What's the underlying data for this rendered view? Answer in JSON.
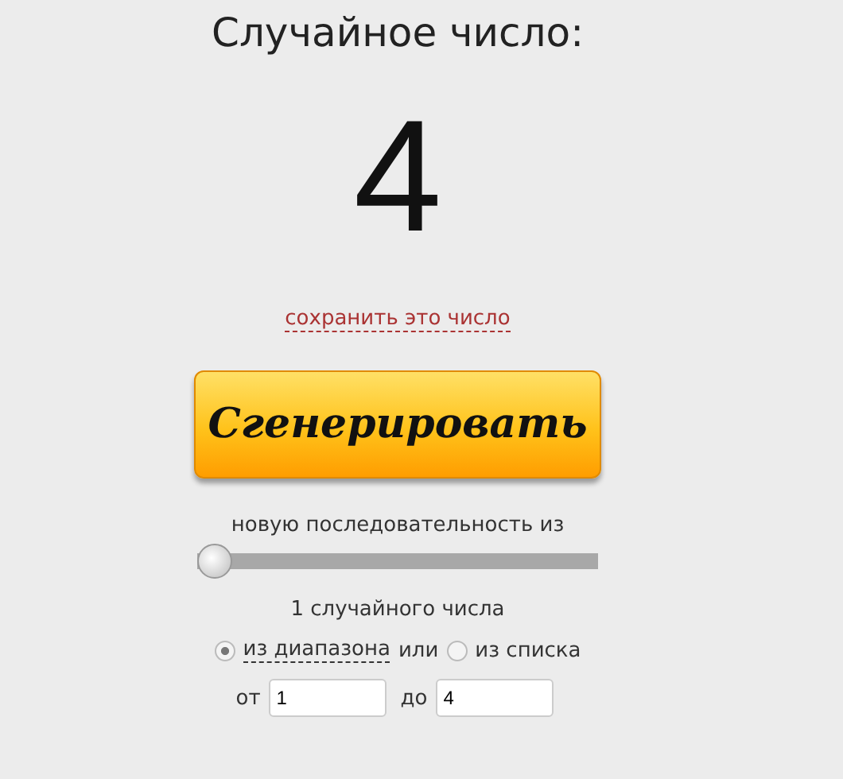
{
  "title": "Случайное число:",
  "result": "4",
  "save_link": "сохранить это число",
  "generate_button": "Сгенерировать",
  "sequence_label": "новую последовательность из",
  "count_slider": {
    "level": 0
  },
  "count_text": "1 случайного числа",
  "source_options": [
    {
      "label": "из диапазона",
      "selected": true,
      "kind": "link"
    },
    {
      "label": "или",
      "kind": "text"
    },
    {
      "label": "из списка",
      "selected": false,
      "kind": "plain"
    }
  ],
  "range": [
    {
      "label": "от",
      "value": "1"
    },
    {
      "label": "до",
      "value": "4"
    }
  ]
}
